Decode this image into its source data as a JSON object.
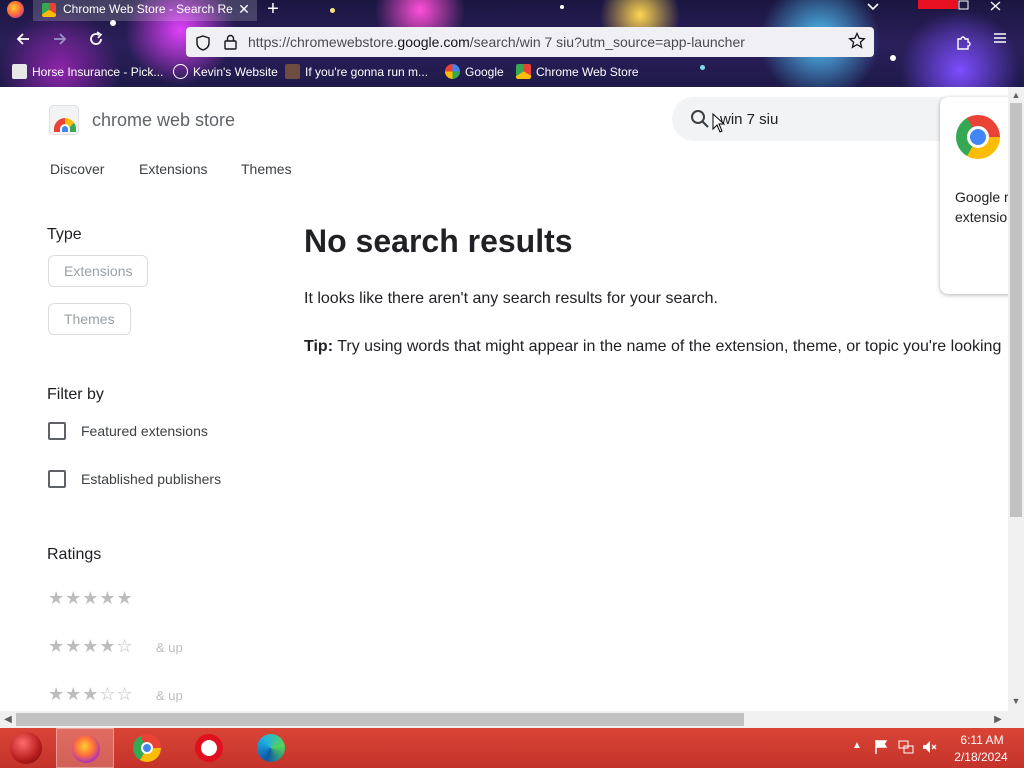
{
  "browser": {
    "tab": {
      "title": "Chrome Web Store - Search Res",
      "close": "✕"
    },
    "new_tab": "+",
    "url": {
      "prefix": "https://chromewebstore.",
      "domain": "google.com",
      "suffix": "/search/win 7 siu?utm_source=app-launcher"
    },
    "bookmarks": [
      {
        "label": "Horse Insurance - Pick..."
      },
      {
        "label": "Kevin's Website"
      },
      {
        "label": "If you're gonna run m..."
      },
      {
        "label": "Google"
      },
      {
        "label": "Chrome Web Store"
      }
    ]
  },
  "store": {
    "name": "chrome web store",
    "search_value": "win 7 siu",
    "nav": [
      "Discover",
      "Extensions",
      "Themes"
    ],
    "popup_text": [
      "Google r",
      "extensio"
    ]
  },
  "sidebar": {
    "type_heading": "Type",
    "type_chips": [
      "Extensions",
      "Themes"
    ],
    "filter_heading": "Filter by",
    "filters": [
      "Featured extensions",
      "Established publishers"
    ],
    "ratings_heading": "Ratings",
    "ratings": [
      {
        "stars": 5,
        "suffix": ""
      },
      {
        "stars": 4,
        "suffix": "& up"
      },
      {
        "stars": 3,
        "suffix": "& up"
      }
    ]
  },
  "results": {
    "title": "No search results",
    "description": "It looks like there aren't any search results for your search.",
    "tip_label": "Tip:",
    "tip_text": " Try using words that might appear in the name of the extension, theme, or topic you're looking"
  },
  "taskbar": {
    "time": "6:11 AM",
    "date": "2/18/2024"
  },
  "colors": {
    "taskbar": "#c4332a",
    "accent_text": "#202124"
  }
}
